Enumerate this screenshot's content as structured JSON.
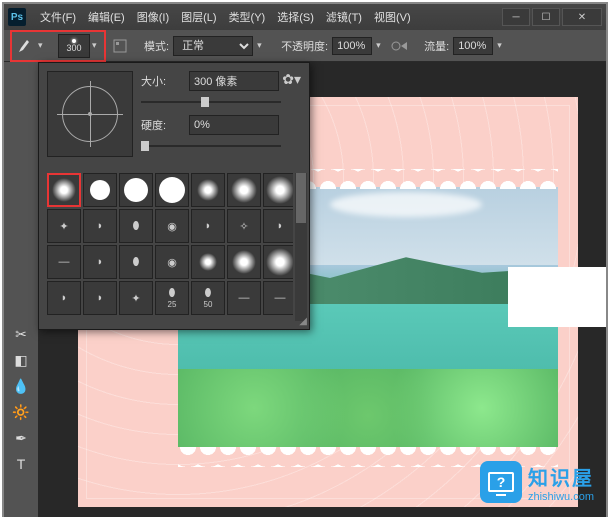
{
  "app": {
    "logo": "Ps"
  },
  "menu": {
    "file": "文件(F)",
    "edit": "编辑(E)",
    "image": "图像(I)",
    "layer": "图层(L)",
    "type": "类型(Y)",
    "select": "选择(S)",
    "filter": "滤镜(T)",
    "view": "视图(V)"
  },
  "optionbar": {
    "brush_size_display": "300",
    "mode_label": "模式:",
    "mode_value": "正常",
    "opacity_label": "不透明度:",
    "opacity_value": "100%",
    "flow_label": "流量:",
    "flow_value": "100%"
  },
  "brush_popup": {
    "size_label": "大小:",
    "size_value": "300 像素",
    "hardness_label": "硬度:",
    "hardness_value": "0%",
    "preset_labels": {
      "25": "25",
      "50": "50"
    }
  },
  "watermark": {
    "icon_text": "?",
    "title": "知识屋",
    "url": "zhishiwu.com"
  },
  "colors": {
    "highlight_red": "#e83535",
    "brand_blue": "#2aa0e8",
    "ui_bg": "#535353"
  }
}
